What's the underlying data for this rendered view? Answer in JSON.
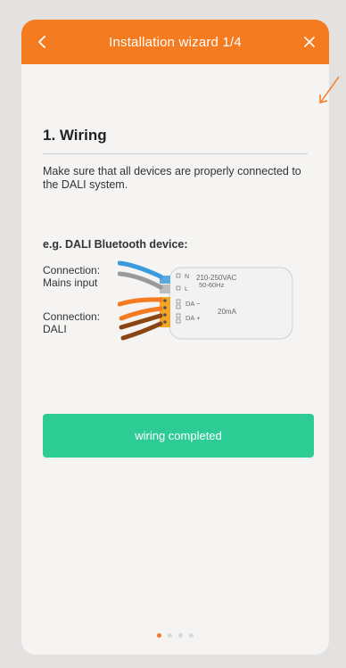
{
  "header": {
    "title": "Installation wizard 1/4",
    "back_icon": "chevron-left-icon",
    "close_icon": "close-icon",
    "bg_color": "#f47b20"
  },
  "step": {
    "title": "1. Wiring",
    "description": "Make sure that all devices are properly connected to the DALI system."
  },
  "example": {
    "label": "e.g. DALI Bluetooth device:",
    "connection_mains": "Connection:\nMains input",
    "connection_dali": "Connection:\nDALI",
    "terminal_n": "N",
    "terminal_l": "L",
    "voltage": "210-250VAC",
    "frequency": "50-60Hz",
    "da_minus": "DA −",
    "da_plus": "DA +",
    "current": "20mA"
  },
  "actions": {
    "complete_label": "wiring completed",
    "complete_color": "#2ecc95"
  },
  "pager": {
    "total": 4,
    "active": 1
  }
}
